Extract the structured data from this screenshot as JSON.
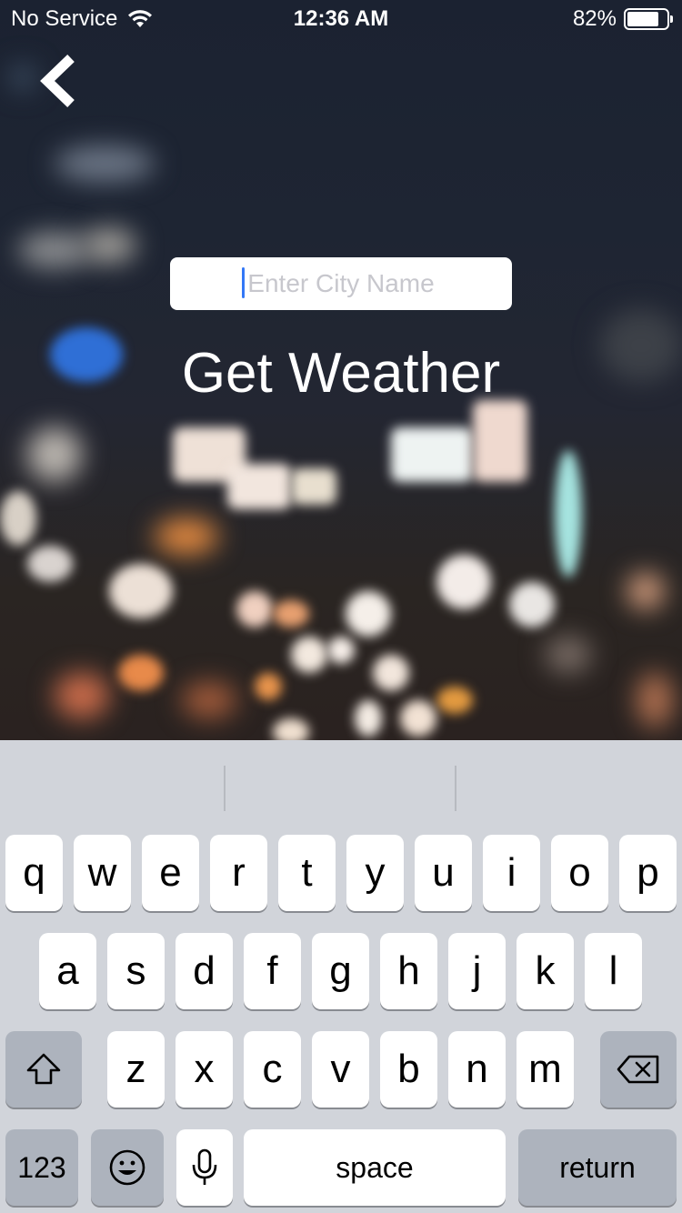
{
  "status_bar": {
    "carrier": "No Service",
    "time": "12:36 AM",
    "battery": "82%",
    "battery_level": 0.82
  },
  "search": {
    "placeholder": "Enter City Name",
    "value": ""
  },
  "main": {
    "action_label": "Get Weather"
  },
  "keyboard": {
    "row1": [
      "q",
      "w",
      "e",
      "r",
      "t",
      "y",
      "u",
      "i",
      "o",
      "p"
    ],
    "row2": [
      "a",
      "s",
      "d",
      "f",
      "g",
      "h",
      "j",
      "k",
      "l"
    ],
    "row3": [
      "z",
      "x",
      "c",
      "v",
      "b",
      "n",
      "m"
    ],
    "numbers_label": "123",
    "space_label": "space",
    "return_label": "return"
  },
  "colors": {
    "caret": "#3478f6",
    "keyboard_bg": "#d1d4da",
    "key_dark": "#adb3bd"
  }
}
